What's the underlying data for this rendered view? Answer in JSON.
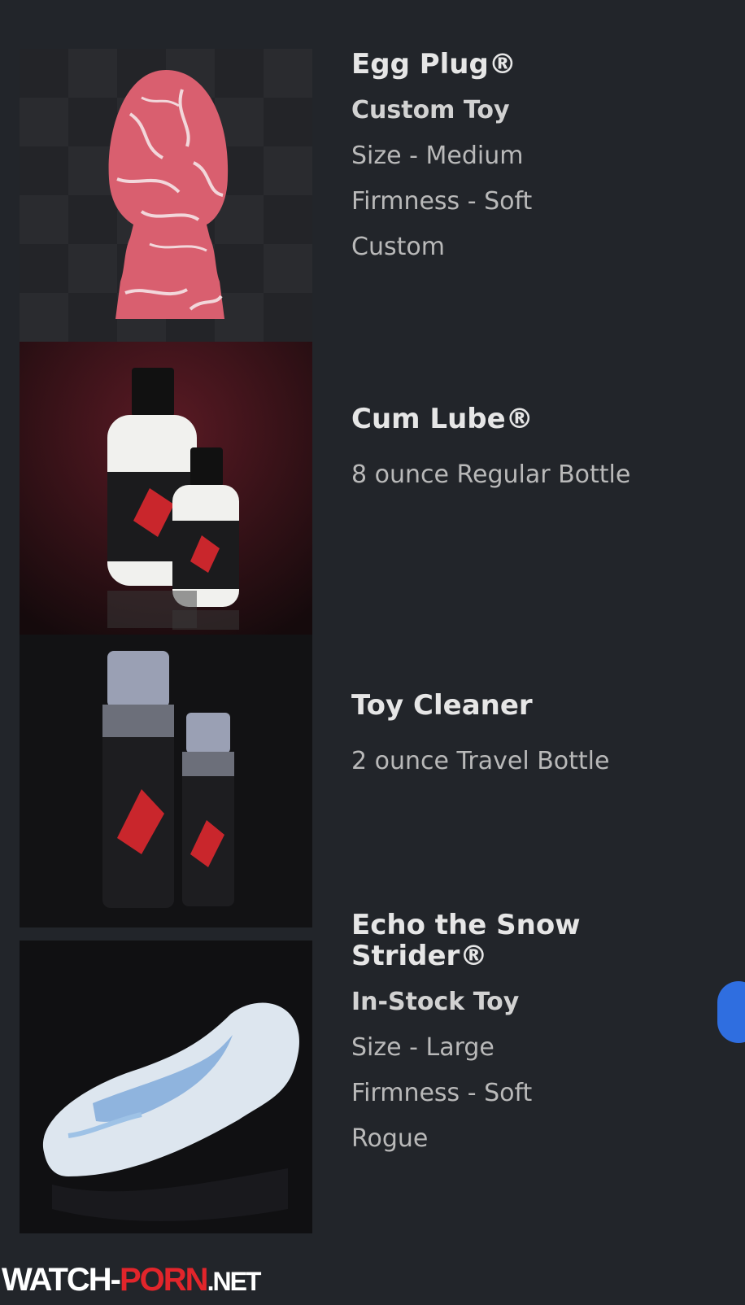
{
  "items": [
    {
      "title": "Egg Plug®",
      "subtitle": "Custom Toy",
      "lines": [
        "Size - Medium",
        "Firmness - Soft",
        "Custom"
      ],
      "thumbnail": "pink-marbled-egg-toy-photo"
    },
    {
      "title": "Cum Lube®",
      "subtitle": "",
      "lines": [
        "8 ounce Regular Bottle"
      ],
      "thumbnail": "white-lube-bottles-photo"
    },
    {
      "title": "Toy Cleaner",
      "subtitle": "",
      "lines": [
        "2 ounce Travel Bottle"
      ],
      "thumbnail": "toy-cleaner-bottles-photo"
    },
    {
      "title": "Echo the Snow Strider®",
      "subtitle": "In-Stock Toy",
      "lines": [
        "Size - Large",
        "Firmness - Soft",
        "Rogue"
      ],
      "thumbnail": "blue-white-marbled-toy-photo"
    }
  ],
  "watermark": {
    "part1": "WATCH-",
    "part2": "PORN",
    "part3": ".NET"
  },
  "colors": {
    "background": "#22252a",
    "title": "#e6e6e6",
    "body_text": "#b9b9b9",
    "accent": "#2f6ee0",
    "watermark_red": "#e2252b"
  }
}
